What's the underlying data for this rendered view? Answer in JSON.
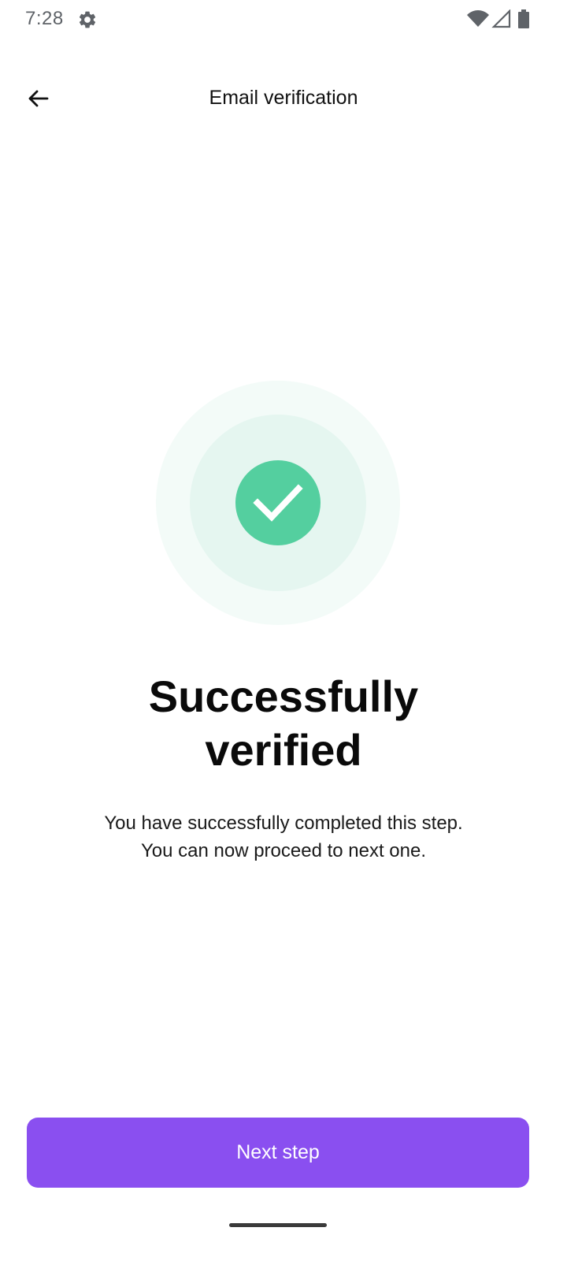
{
  "status_bar": {
    "time": "7:28",
    "icons": [
      "gear-icon",
      "wifi-icon",
      "signal-icon",
      "battery-icon"
    ]
  },
  "header": {
    "back_icon": "arrow-left-icon",
    "title": "Email verification"
  },
  "hero": {
    "icon": "check-icon",
    "colors": {
      "outer_ring": "#f3fbf8",
      "inner_ring": "#e5f6f0",
      "check_circle": "#54cf9f"
    }
  },
  "content": {
    "headline_line1": "Successfully",
    "headline_line2": "verified",
    "description_line1": "You have successfully completed this step.",
    "description_line2": "You can now proceed to next one."
  },
  "footer": {
    "next_button_label": "Next step",
    "accent_color": "#8a4ff0"
  }
}
